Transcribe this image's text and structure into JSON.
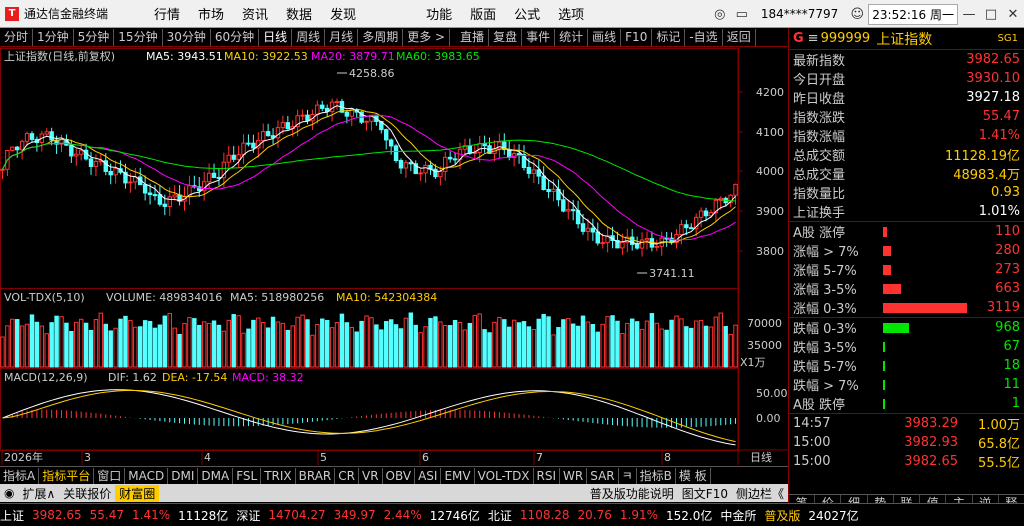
{
  "app": {
    "logo": "T",
    "title": "通达信金融终端"
  },
  "main_menu": [
    "行情",
    "市场",
    "资讯",
    "数据",
    "发现",
    "功能",
    "版面",
    "公式",
    "选项"
  ],
  "user": "184****7797",
  "clock": "23:52:16 周一",
  "toolbar": [
    "分时",
    "1分钟",
    "5分钟",
    "15分钟",
    "30分钟",
    "60分钟",
    "日线",
    "周线",
    "月线",
    "多周期",
    "更多 >",
    "直播",
    "复盘",
    "事件",
    "统计",
    "画线",
    "F10",
    "标记",
    "-自选",
    "返回"
  ],
  "toolbar_active": 6,
  "chart": {
    "title": "上证指数(日线,前复权)",
    "ma5": "MA5: 3943.51",
    "ma10": "MA10: 3922.53",
    "ma20": "MA20: 3879.71",
    "ma60": "MA60: 3983.65",
    "high_label": "4258.86",
    "low_label": "3741.11",
    "vol_title": "VOL-TDX(5,10)",
    "vol_value": "VOLUME: 489834016",
    "vol_ma5": "MA5: 518980256",
    "vol_ma10": "MA10: 542304384",
    "vol_unit": "X1万",
    "macd_title": "MACD(12,26,9)",
    "macd_dif": "DIF: 1.62",
    "macd_dea": "DEA: -17.54",
    "macd_val": "MACD: 38.32",
    "price_axis": [
      "4200",
      "4100",
      "4000",
      "3900",
      "3800"
    ],
    "vol_axis": [
      "70000",
      "35000"
    ],
    "macd_axis": [
      "50.00",
      "0.00"
    ],
    "date_labels": [
      "2026年",
      "3",
      "4",
      "5",
      "6",
      "7",
      "8"
    ],
    "period_label": "日线"
  },
  "right": {
    "code": "999999",
    "name": "上证指数",
    "badge": "SG1",
    "rows": [
      {
        "label": "最新指数",
        "value": "3982.65",
        "color": "red"
      },
      {
        "label": "今日开盘",
        "value": "3930.10",
        "color": "red"
      },
      {
        "label": "昨日收盘",
        "value": "3927.18",
        "color": "white"
      },
      {
        "label": "指数涨跌",
        "value": "55.47",
        "color": "red"
      },
      {
        "label": "指数涨幅",
        "value": "1.41%",
        "color": "red"
      },
      {
        "label": "总成交额",
        "value": "11128.19亿",
        "color": "yellow"
      },
      {
        "label": "总成交量",
        "value": "48983.4万",
        "color": "yellow"
      },
      {
        "label": "指数量比",
        "value": "0.93",
        "color": "yellow"
      },
      {
        "label": "上证换手",
        "value": "1.01%",
        "color": "white"
      }
    ],
    "ups": [
      {
        "label": "A股 涨停",
        "value": "110",
        "pct": 2
      },
      {
        "label": "涨幅 > 7%",
        "value": "280",
        "pct": 4
      },
      {
        "label": "涨幅 5-7%",
        "value": "273",
        "pct": 4
      },
      {
        "label": "涨幅 3-5%",
        "value": "663",
        "pct": 9
      },
      {
        "label": "涨幅 0-3%",
        "value": "3119",
        "pct": 42
      }
    ],
    "downs": [
      {
        "label": "跌幅 0-3%",
        "value": "968",
        "pct": 13
      },
      {
        "label": "跌幅 3-5%",
        "value": "67",
        "pct": 1
      },
      {
        "label": "跌幅 5-7%",
        "value": "18",
        "pct": 1
      },
      {
        "label": "跌幅 > 7%",
        "value": "11",
        "pct": 1
      },
      {
        "label": "A股 跌停",
        "value": "1",
        "pct": 1
      }
    ],
    "ticks": [
      {
        "time": "14:57",
        "price": "3983.29",
        "vol": "1.00万"
      },
      {
        "time": "15:00",
        "price": "3982.93",
        "vol": "65.8亿"
      },
      {
        "time": "15:00",
        "price": "3982.65",
        "vol": "55.5亿"
      }
    ],
    "tabs": [
      "笔",
      "价",
      "细",
      "势",
      "联",
      "值",
      "主",
      "逆",
      "释"
    ]
  },
  "bottom_tabs": [
    "指标A",
    "指标平台",
    "窗口",
    "MACD",
    "DMI",
    "DMA",
    "FSL",
    "TRIX",
    "BRAR",
    "CR",
    "VR",
    "OBV",
    "ASI",
    "EMV",
    "VOL-TDX",
    "RSI",
    "WR",
    "SAR",
    "ㅋ",
    "指标B",
    "模 板"
  ],
  "bottom_active": 1,
  "sub_bar": [
    "扩展∧",
    "关联报价",
    "财富圈"
  ],
  "sub_bar_right": [
    "普及版功能说明",
    "图文F10",
    "侧边栏《"
  ],
  "status": [
    {
      "text": "上证",
      "color": "white"
    },
    {
      "text": "3982.65",
      "color": "red"
    },
    {
      "text": "55.47",
      "color": "red"
    },
    {
      "text": "1.41%",
      "color": "red"
    },
    {
      "text": "11128亿",
      "color": "white"
    },
    {
      "text": "深证",
      "color": "white"
    },
    {
      "text": "14704.27",
      "color": "red"
    },
    {
      "text": "349.97",
      "color": "red"
    },
    {
      "text": "2.44%",
      "color": "red"
    },
    {
      "text": "12746亿",
      "color": "white"
    },
    {
      "text": "北证",
      "color": "white"
    },
    {
      "text": "1108.28",
      "color": "red"
    },
    {
      "text": "20.76",
      "color": "red"
    },
    {
      "text": "1.91%",
      "color": "red"
    },
    {
      "text": "152.0亿",
      "color": "white"
    },
    {
      "text": "中金所",
      "color": "white"
    },
    {
      "text": "普及版",
      "color": "yellow"
    },
    {
      "text": "24027亿",
      "color": "white"
    }
  ],
  "colors": {
    "up": "#ff3232",
    "down": "#54ffff",
    "ma5": "#ffffff",
    "ma10": "#ffcc00",
    "ma20": "#ff00ff",
    "ma60": "#00e600",
    "frame": "#800000"
  }
}
